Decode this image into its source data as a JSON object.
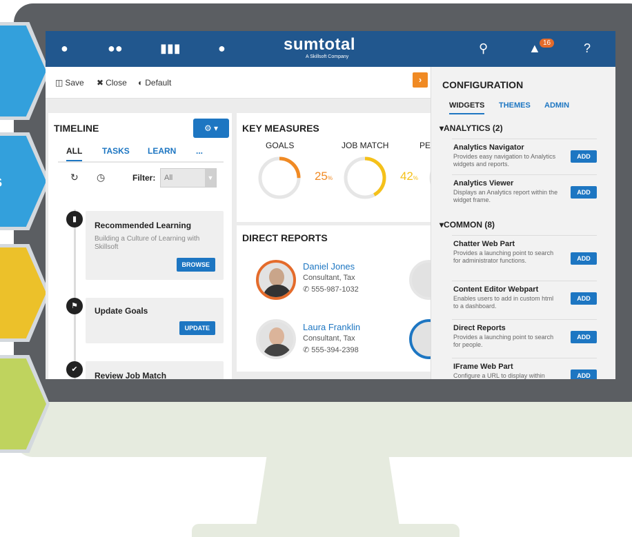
{
  "app": {
    "logo": "sumtotal",
    "logo_sub": "A Skillsoft Company",
    "notification_count": "16"
  },
  "nav_icons": [
    "person-icon",
    "group-icon",
    "library-icon",
    "user-settings-icon",
    "search-icon",
    "bell-icon",
    "help-icon"
  ],
  "toolbar": {
    "save": "Save",
    "close": "Close",
    "default": "Default"
  },
  "timeline": {
    "title": "TIMELINE",
    "tabs": [
      "ALL",
      "TASKS",
      "LEARN",
      "..."
    ],
    "filter_label": "Filter:",
    "filter_value": "All",
    "cards": [
      {
        "title": "Recommended Learning",
        "desc": "Building a Culture of Learning with Skillsoft",
        "button": "BROWSE"
      },
      {
        "title": "Update Goals",
        "desc": "",
        "button": "UPDATE"
      },
      {
        "title": "Review Job Match",
        "desc": "",
        "button": ""
      }
    ]
  },
  "measures": {
    "title": "KEY MEASURES",
    "items": [
      {
        "label": "GOALS",
        "value": "25",
        "unit": "%",
        "fraction": 0.25,
        "color": "#f08a24"
      },
      {
        "label": "JOB MATCH",
        "value": "42",
        "unit": "%",
        "fraction": 0.42,
        "color": "#f5c11a"
      },
      {
        "label": "PE",
        "value": "",
        "unit": "",
        "fraction": 0,
        "color": "#3ab39a"
      }
    ]
  },
  "reports": {
    "title": "DIRECT REPORTS",
    "people": [
      {
        "name": "Daniel Jones",
        "title": "Consultant, Tax",
        "phone": "555-987-1032"
      },
      {
        "name": "Laura Franklin",
        "title": "Consultant, Tax",
        "phone": "555-394-2398"
      }
    ]
  },
  "config": {
    "title": "CONFIGURATION",
    "tabs": [
      "WIDGETS",
      "THEMES",
      "ADMIN"
    ],
    "sections": [
      {
        "name": "ANALYTICS (2)"
      },
      {
        "name": "COMMON (8)"
      }
    ],
    "items": [
      {
        "name": "Analytics Navigator",
        "desc": "Provides easy navigation to Analytics widgets and reports.",
        "button": "ADD"
      },
      {
        "name": "Analytics Viewer",
        "desc": "Displays an Analytics report within the widget frame.",
        "button": "ADD"
      },
      {
        "name": "Chatter Web Part",
        "desc": "Provides a launching point to search for administrator functions.",
        "button": "ADD"
      },
      {
        "name": "Content Editor Webpart",
        "desc": "Enables users to add in custom html to a dashboard.",
        "button": "ADD"
      },
      {
        "name": "Direct Reports",
        "desc": "Provides a launching point to search for people.",
        "button": "ADD"
      },
      {
        "name": "IFrame Web Part",
        "desc": "Configure a URL to display within",
        "button": "ADD"
      }
    ]
  }
}
